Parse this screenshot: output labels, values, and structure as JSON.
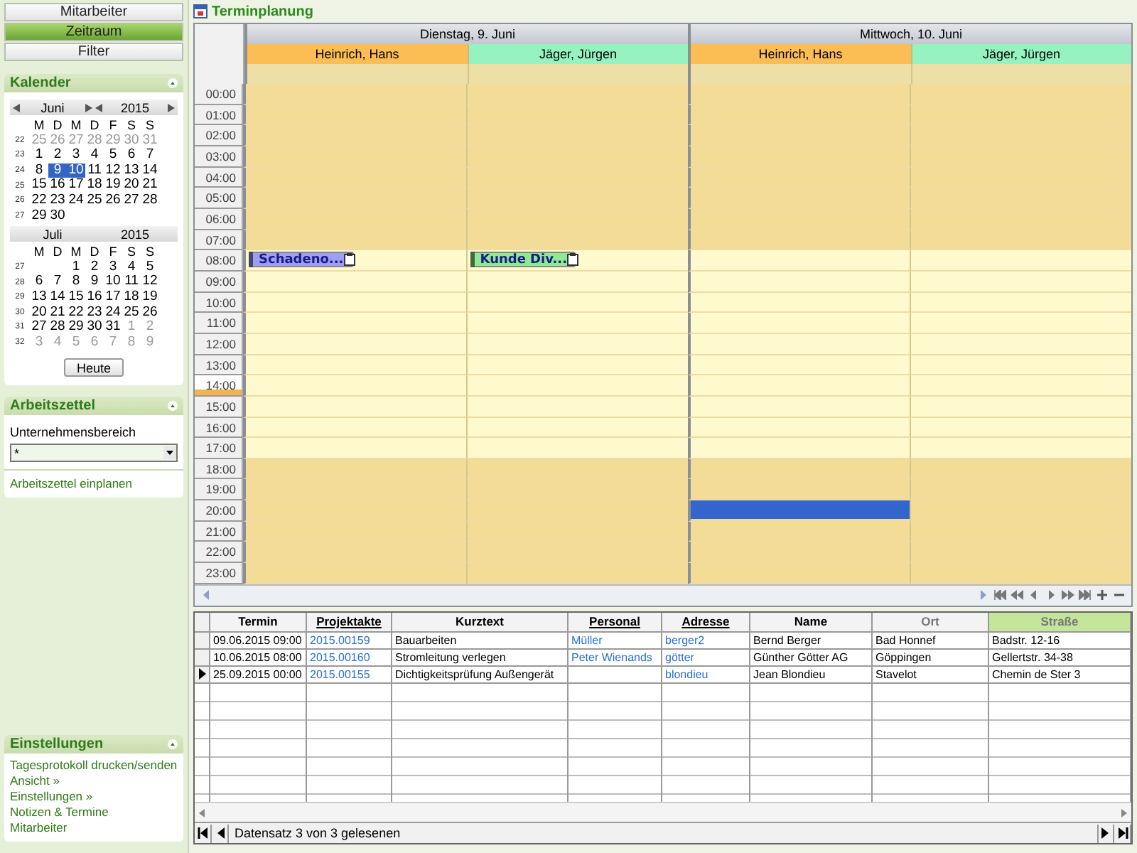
{
  "nav_buttons": [
    {
      "label": "Mitarbeiter",
      "selected": false
    },
    {
      "label": "Zeitraum",
      "selected": true
    },
    {
      "label": "Filter",
      "selected": false
    }
  ],
  "calendar_panel": {
    "title": "Kalender",
    "today_button": "Heute",
    "months": [
      {
        "month": "Juni",
        "year": "2015",
        "nav": true,
        "weekdays": [
          "M",
          "D",
          "M",
          "D",
          "F",
          "S",
          "S"
        ],
        "weeks": [
          {
            "week": "22",
            "days": [
              {
                "d": "25",
                "other": true,
                "selected": false
              },
              {
                "d": "26",
                "other": true,
                "selected": false
              },
              {
                "d": "27",
                "other": true,
                "selected": false
              },
              {
                "d": "28",
                "other": true,
                "selected": false
              },
              {
                "d": "29",
                "other": true,
                "selected": false
              },
              {
                "d": "30",
                "other": true,
                "selected": false
              },
              {
                "d": "31",
                "other": true,
                "selected": false
              }
            ]
          },
          {
            "week": "23",
            "days": [
              {
                "d": "1",
                "other": false,
                "selected": false
              },
              {
                "d": "2",
                "other": false,
                "selected": false
              },
              {
                "d": "3",
                "other": false,
                "selected": false
              },
              {
                "d": "4",
                "other": false,
                "selected": false
              },
              {
                "d": "5",
                "other": false,
                "selected": false
              },
              {
                "d": "6",
                "other": false,
                "selected": false
              },
              {
                "d": "7",
                "other": false,
                "selected": false
              }
            ]
          },
          {
            "week": "24",
            "days": [
              {
                "d": "8",
                "other": false,
                "selected": false
              },
              {
                "d": "9",
                "other": false,
                "selected": true
              },
              {
                "d": "10",
                "other": false,
                "selected": true
              },
              {
                "d": "11",
                "other": false,
                "selected": false
              },
              {
                "d": "12",
                "other": false,
                "selected": false
              },
              {
                "d": "13",
                "other": false,
                "selected": false
              },
              {
                "d": "14",
                "other": false,
                "selected": false
              }
            ]
          },
          {
            "week": "25",
            "days": [
              {
                "d": "15",
                "other": false,
                "selected": false
              },
              {
                "d": "16",
                "other": false,
                "selected": false
              },
              {
                "d": "17",
                "other": false,
                "selected": false
              },
              {
                "d": "18",
                "other": false,
                "selected": false
              },
              {
                "d": "19",
                "other": false,
                "selected": false
              },
              {
                "d": "20",
                "other": false,
                "selected": false
              },
              {
                "d": "21",
                "other": false,
                "selected": false
              }
            ]
          },
          {
            "week": "26",
            "days": [
              {
                "d": "22",
                "other": false,
                "selected": false
              },
              {
                "d": "23",
                "other": false,
                "selected": false
              },
              {
                "d": "24",
                "other": false,
                "selected": false
              },
              {
                "d": "25",
                "other": false,
                "selected": false
              },
              {
                "d": "26",
                "other": false,
                "selected": false
              },
              {
                "d": "27",
                "other": false,
                "selected": false
              },
              {
                "d": "28",
                "other": false,
                "selected": false
              }
            ]
          },
          {
            "week": "27",
            "days": [
              {
                "d": "29",
                "other": false,
                "selected": false
              },
              {
                "d": "30",
                "other": false,
                "selected": false
              }
            ]
          }
        ]
      },
      {
        "month": "Juli",
        "year": "2015",
        "nav": false,
        "weekdays": [
          "M",
          "D",
          "M",
          "D",
          "F",
          "S",
          "S"
        ],
        "weeks": [
          {
            "week": "27",
            "right_aligned": true,
            "days": [
              {
                "d": "1",
                "other": false,
                "selected": false
              },
              {
                "d": "2",
                "other": false,
                "selected": false
              },
              {
                "d": "3",
                "other": false,
                "selected": false
              },
              {
                "d": "4",
                "other": false,
                "selected": false
              },
              {
                "d": "5",
                "other": false,
                "selected": false
              }
            ]
          },
          {
            "week": "28",
            "days": [
              {
                "d": "6",
                "other": false,
                "selected": false
              },
              {
                "d": "7",
                "other": false,
                "selected": false
              },
              {
                "d": "8",
                "other": false,
                "selected": false
              },
              {
                "d": "9",
                "other": false,
                "selected": false
              },
              {
                "d": "10",
                "other": false,
                "selected": false
              },
              {
                "d": "11",
                "other": false,
                "selected": false
              },
              {
                "d": "12",
                "other": false,
                "selected": false
              }
            ]
          },
          {
            "week": "29",
            "days": [
              {
                "d": "13",
                "other": false,
                "selected": false
              },
              {
                "d": "14",
                "other": false,
                "selected": false
              },
              {
                "d": "15",
                "other": false,
                "selected": false
              },
              {
                "d": "16",
                "other": false,
                "selected": false
              },
              {
                "d": "17",
                "other": false,
                "selected": false
              },
              {
                "d": "18",
                "other": false,
                "selected": false
              },
              {
                "d": "19",
                "other": false,
                "selected": false
              }
            ]
          },
          {
            "week": "30",
            "days": [
              {
                "d": "20",
                "other": false,
                "selected": false
              },
              {
                "d": "21",
                "other": false,
                "selected": false
              },
              {
                "d": "22",
                "other": false,
                "selected": false
              },
              {
                "d": "23",
                "other": false,
                "selected": false
              },
              {
                "d": "24",
                "other": false,
                "selected": false
              },
              {
                "d": "25",
                "other": false,
                "selected": false
              },
              {
                "d": "26",
                "other": false,
                "selected": false
              }
            ]
          },
          {
            "week": "31",
            "days": [
              {
                "d": "27",
                "other": false,
                "selected": false
              },
              {
                "d": "28",
                "other": false,
                "selected": false
              },
              {
                "d": "29",
                "other": false,
                "selected": false
              },
              {
                "d": "30",
                "other": false,
                "selected": false
              },
              {
                "d": "31",
                "other": false,
                "selected": false
              },
              {
                "d": "1",
                "other": true,
                "selected": false
              },
              {
                "d": "2",
                "other": true,
                "selected": false
              }
            ]
          },
          {
            "week": "32",
            "days": [
              {
                "d": "3",
                "other": true,
                "selected": false
              },
              {
                "d": "4",
                "other": true,
                "selected": false
              },
              {
                "d": "5",
                "other": true,
                "selected": false
              },
              {
                "d": "6",
                "other": true,
                "selected": false
              },
              {
                "d": "7",
                "other": true,
                "selected": false
              },
              {
                "d": "8",
                "other": true,
                "selected": false
              },
              {
                "d": "9",
                "other": true,
                "selected": false
              }
            ]
          }
        ]
      }
    ]
  },
  "worksheet_panel": {
    "title": "Arbeitszettel",
    "field_label": "Unternehmensbereich",
    "select_value": "*",
    "link": "Arbeitszettel einplanen"
  },
  "settings_panel": {
    "title": "Einstellungen",
    "links": [
      "Tagesprotokoll drucken/senden",
      "Ansicht »",
      "Einstellungen »",
      "Notizen & Termine",
      "Mitarbeiter"
    ]
  },
  "scheduler": {
    "title": "Terminplanung",
    "days": [
      {
        "label": "Dienstag, 9. Juni",
        "resources": [
          {
            "name": "Heinrich, Hans",
            "color": "#fdbd55"
          },
          {
            "name": "Jäger, Jürgen",
            "color": "#96f2c0"
          }
        ]
      },
      {
        "label": "Mittwoch, 10. Juni",
        "resources": [
          {
            "name": "Heinrich, Hans",
            "color": "#fdbd55"
          },
          {
            "name": "Jäger, Jürgen",
            "color": "#96f2c0"
          }
        ]
      }
    ],
    "hours": [
      {
        "label": "00:00",
        "working": false,
        "current": false
      },
      {
        "label": "01:00",
        "working": false,
        "current": false
      },
      {
        "label": "02:00",
        "working": false,
        "current": false
      },
      {
        "label": "03:00",
        "working": false,
        "current": false
      },
      {
        "label": "04:00",
        "working": false,
        "current": false
      },
      {
        "label": "05:00",
        "working": false,
        "current": false
      },
      {
        "label": "06:00",
        "working": false,
        "current": false
      },
      {
        "label": "07:00",
        "working": false,
        "current": false
      },
      {
        "label": "08:00",
        "working": true,
        "current": false,
        "cells": [
          {
            "kind": "appointment",
            "title": "Schadeno...",
            "color": "#9e9ef2"
          },
          {
            "kind": "appointment",
            "title": "Kunde Div...",
            "color": "#90e890"
          },
          {
            "kind": "empty"
          },
          {
            "kind": "empty"
          }
        ]
      },
      {
        "label": "09:00",
        "working": true,
        "current": false
      },
      {
        "label": "10:00",
        "working": true,
        "current": false
      },
      {
        "label": "11:00",
        "working": true,
        "current": false
      },
      {
        "label": "12:00",
        "working": true,
        "current": false
      },
      {
        "label": "13:00",
        "working": true,
        "current": false
      },
      {
        "label": "14:00",
        "working": true,
        "current": true
      },
      {
        "label": "15:00",
        "working": true,
        "current": false
      },
      {
        "label": "16:00",
        "working": true,
        "current": false
      },
      {
        "label": "17:00",
        "working": true,
        "current": false
      },
      {
        "label": "18:00",
        "working": false,
        "current": false
      },
      {
        "label": "19:00",
        "working": false,
        "current": false
      },
      {
        "label": "20:00",
        "working": false,
        "current": false,
        "cells": [
          {
            "kind": "empty"
          },
          {
            "kind": "empty"
          },
          {
            "kind": "selection",
            "color": "#3366cc"
          },
          {
            "kind": "empty"
          }
        ]
      },
      {
        "label": "21:00",
        "working": false,
        "current": false
      },
      {
        "label": "22:00",
        "working": false,
        "current": false
      },
      {
        "label": "23:00",
        "working": false,
        "current": false
      }
    ]
  },
  "table": {
    "columns": [
      {
        "label": "Termin",
        "link": false,
        "selected": false,
        "disabled": false
      },
      {
        "label": "Projektakte",
        "link": true,
        "selected": false,
        "disabled": false
      },
      {
        "label": "Kurztext",
        "link": false,
        "selected": false,
        "disabled": false
      },
      {
        "label": "Personal",
        "link": true,
        "selected": false,
        "disabled": false
      },
      {
        "label": "Adresse",
        "link": true,
        "selected": false,
        "disabled": false
      },
      {
        "label": "Name",
        "link": false,
        "selected": false,
        "disabled": false
      },
      {
        "label": "Ort",
        "link": false,
        "selected": false,
        "disabled": true
      },
      {
        "label": "Straße",
        "link": false,
        "selected": true,
        "disabled": false
      }
    ],
    "rows": [
      {
        "current": false,
        "cells": [
          "09.06.2015 09:00",
          "2015.00159",
          "Bauarbeiten",
          "Müller",
          "berger2",
          "Bernd Berger",
          "Bad Honnef",
          "Badstr. 12-16"
        ]
      },
      {
        "current": false,
        "cells": [
          "10.06.2015 08:00",
          "2015.00160",
          "Stromleitung verlegen",
          "Peter Wienands",
          "götter",
          "Günther Götter AG",
          "Göppingen",
          "Gellertstr. 34-38"
        ]
      },
      {
        "current": true,
        "cells": [
          "25.09.2015 00:00",
          "2015.00155",
          "Dichtigkeitsprüfung Außengerät",
          null,
          "blondieu",
          "Jean Blondieu",
          "Stavelot",
          "Chemin de Ster 3"
        ]
      }
    ],
    "status": "Datensatz 3 von 3 gelesenen"
  }
}
